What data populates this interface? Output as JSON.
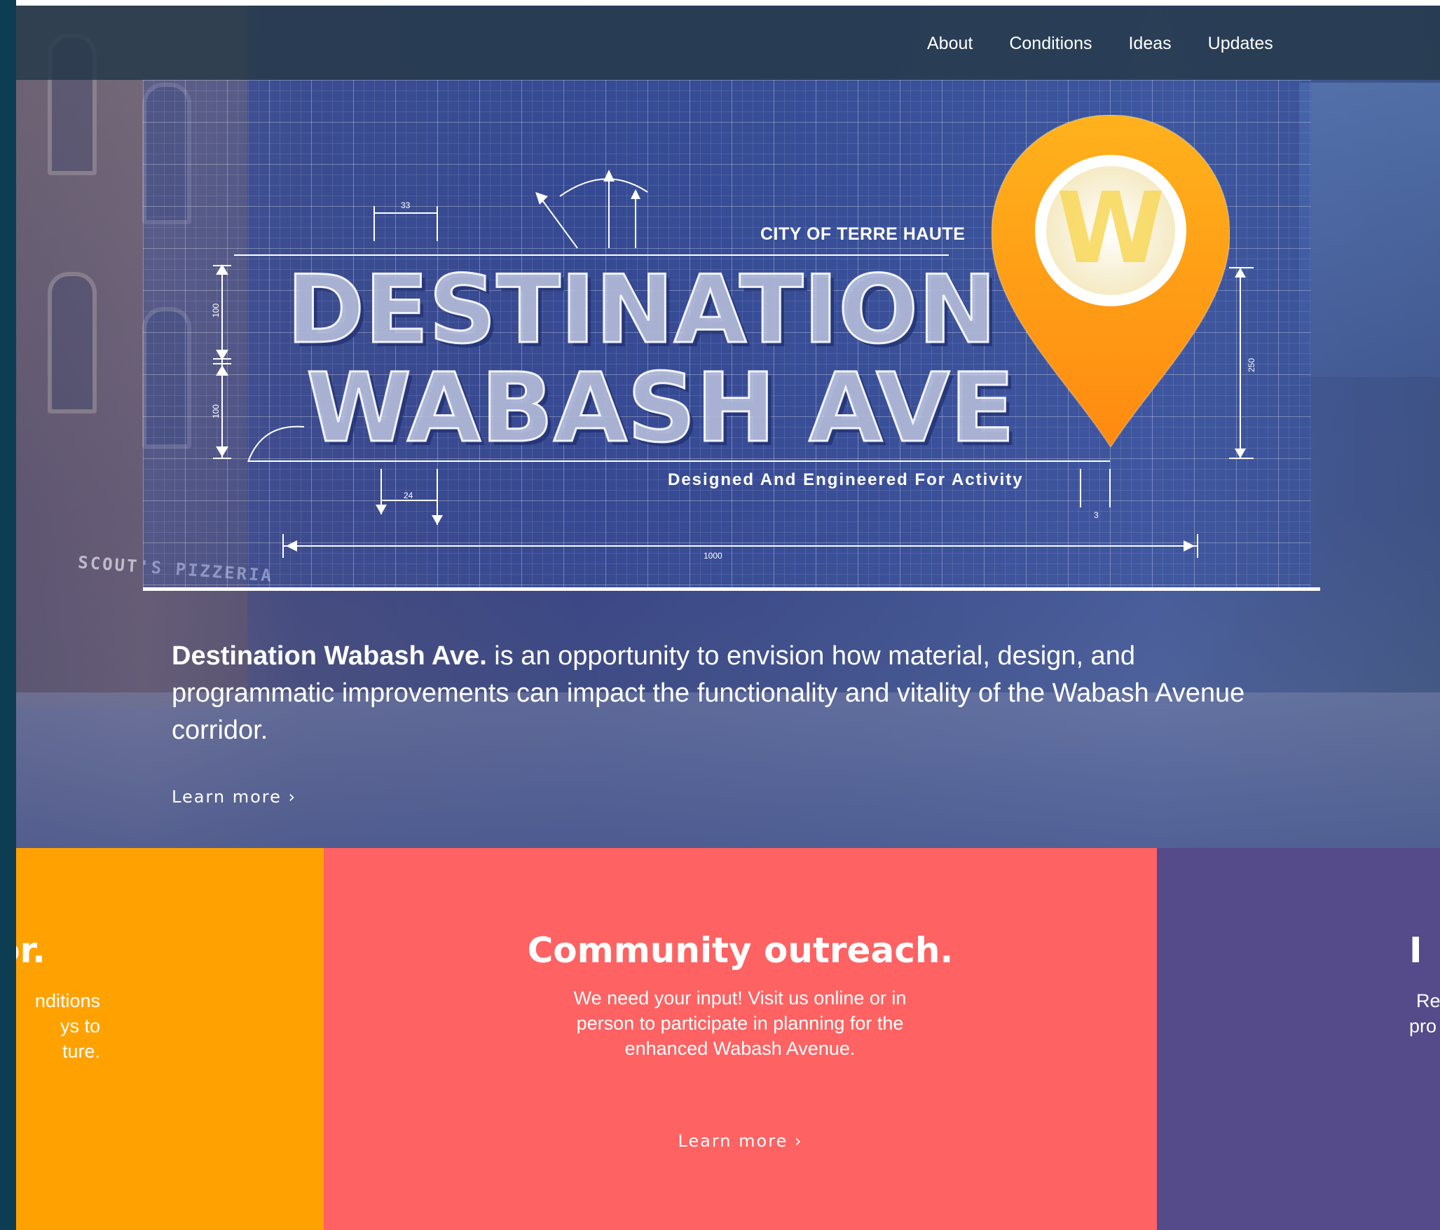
{
  "nav": {
    "items": [
      "About",
      "Conditions",
      "Ideas",
      "Updates"
    ]
  },
  "hero": {
    "city_label": "CITY OF TERRE HAUTE",
    "title_line1": "DESTINATION",
    "title_line2": "WABASH AVE",
    "tagline": "Designed And Engineered For Activity",
    "pin_letter": "W",
    "storefront_sign": "SCOUT'S PIZZERIA",
    "dimensions": {
      "d33": "33",
      "d100a": "100",
      "d100b": "100",
      "d24": "24",
      "d250": "250",
      "d3": "3",
      "d1000": "1000"
    },
    "intro_strong": "Destination Wabash Ave.",
    "intro_text": " is an opportunity to envision how material, design, and programmatic improvements can impact the functionality and vitality of the Wabash Avenue corridor.",
    "learn_more": "Learn more ›"
  },
  "panels": {
    "left": {
      "heading": "lor.",
      "body_lines": [
        "nditions",
        "ys to",
        "ture."
      ]
    },
    "middle": {
      "heading": "Community outreach.",
      "body": "We need your input! Visit us online or in person to participate in planning for the enhanced Wabash Avenue.",
      "learn_more": "Learn more ›"
    },
    "right": {
      "heading": "I",
      "body_lines": [
        "Re",
        "pro"
      ]
    }
  },
  "colors": {
    "nav_bg": "#263a4a",
    "hero_overlay": "#2d4896",
    "panel_orange": "#ffa201",
    "panel_coral": "#fe6262",
    "panel_purple": "#554a8a",
    "pin_orange": "#ff9a16"
  }
}
